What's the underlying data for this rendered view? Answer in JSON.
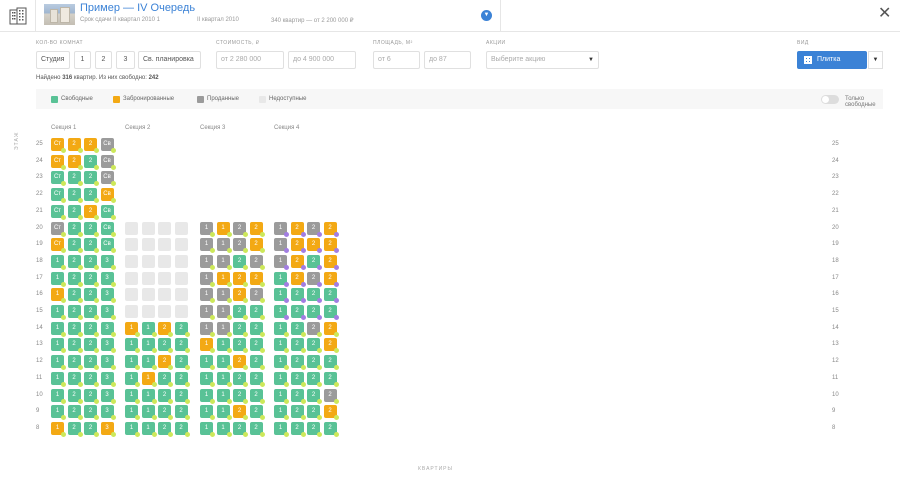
{
  "header": {
    "title": "Пример — IV Очередь",
    "deadline": "Срок сдачи II квартал 2010 1",
    "quarter": "II квартал 2010",
    "apartments": "340 квартир — от 2 200 000 ₽"
  },
  "filters": {
    "rooms": {
      "label": "КОЛ-ВО КОМНАТ",
      "options": [
        "Студия",
        "1",
        "2",
        "3",
        "Св. планировка"
      ]
    },
    "price": {
      "label": "СТОИМОСТЬ, ₽",
      "from": "от  2 280 000",
      "to": "до  4 900 000"
    },
    "area": {
      "label": "ПЛОЩАДЬ, М²",
      "from": "от  6",
      "to": "до  87"
    },
    "promo": {
      "label": "АКЦИИ",
      "placeholder": "Выберите акцию"
    },
    "view": {
      "label": "ВИД",
      "value": "Плитка"
    }
  },
  "summary": {
    "prefix": "Найдено ",
    "total": "316",
    "middle": " квартир. Из них свободно: ",
    "free": "242"
  },
  "legend": {
    "items": [
      {
        "label": "Свободные",
        "color": "#59c296"
      },
      {
        "label": "Забронированные",
        "color": "#f3a914"
      },
      {
        "label": "Проданные",
        "color": "#9b9b9b"
      },
      {
        "label": "Недоступные",
        "color": "#e8e8e8"
      }
    ],
    "toggle_label": "Только свободные"
  },
  "sections": [
    "Секция 1",
    "Секция 2",
    "Секция 3",
    "Секция 4"
  ],
  "axis": {
    "floors_label": "ЭТАЖ",
    "apartments_label": "КВАРТИРЫ"
  },
  "floors": [
    "25",
    "24",
    "23",
    "22",
    "21",
    "20",
    "19",
    "18",
    "17",
    "16",
    "15",
    "14",
    "13",
    "12",
    "11",
    "10",
    "9",
    "8"
  ],
  "grid": [
    [
      "r:Ст,r:2,r:2,s:Св",
      "",
      "",
      ""
    ],
    [
      "r:Ст,r:2,f:2,s:Св",
      "",
      "",
      ""
    ],
    [
      "f:Ст,f:2,f:2,s:Св",
      "",
      "",
      ""
    ],
    [
      "f:Ст,f:2,f:2,r:Св",
      "",
      "",
      ""
    ],
    [
      "f:Ст,f:2,r:2,f:Св",
      "",
      "",
      ""
    ],
    [
      "s:Ст,f:2,f:2,f:Св",
      "n:,n:,n:,n:",
      "s:1,r:1,s:2,r:2",
      "s:1,r:2,s:2,r:2"
    ],
    [
      "r:Ст,f:2,f:2,f:Св",
      "n:,n:,n:,n:",
      "s:1,s:1,s:2,r:2",
      "s:1,r:2,r:2,r:2"
    ],
    [
      "f:1,f:2,f:2,f:3",
      "n:,n:,n:,n:",
      "s:1,s:1,f:2,s:2",
      "s:1,r:2,f:2,r:2"
    ],
    [
      "f:1,f:2,f:2,f:3",
      "n:,n:,n:,n:",
      "s:1,r:1,r:2,r:2",
      "f:1,r:2,s:2,r:2"
    ],
    [
      "r:1,f:2,f:2,f:3",
      "n:,n:,n:,n:",
      "s:1,s:1,r:2,s:2",
      "f:1,f:2,f:2,f:2"
    ],
    [
      "f:1,f:2,f:2,f:3",
      "n:,n:,n:,n:",
      "s:1,s:1,f:2,f:2",
      "f:1,f:2,f:2,f:2"
    ],
    [
      "f:1,f:2,f:2,f:3",
      "r:1,f:1,r:2,f:2",
      "s:1,s:1,f:2,f:2",
      "f:1,f:2,s:2,r:2"
    ],
    [
      "f:1,f:2,f:2,f:3",
      "f:1,f:1,f:2,f:2",
      "r:1,f:1,f:2,f:2",
      "f:1,f:2,f:2,r:2"
    ],
    [
      "f:1,f:2,f:2,f:3",
      "f:1,f:1,r:2,f:2",
      "f:1,f:1,r:2,f:2",
      "f:1,f:2,f:2,f:2"
    ],
    [
      "f:1,f:2,f:2,f:3",
      "f:1,r:1,f:2,f:2",
      "f:1,f:1,f:2,f:2",
      "f:1,f:2,f:2,f:2"
    ],
    [
      "f:1,f:2,f:2,f:3",
      "f:1,f:1,f:2,f:2",
      "f:1,f:1,f:2,f:2",
      "f:1,f:2,f:2,s:2"
    ],
    [
      "f:1,f:2,f:2,f:3",
      "f:1,f:1,f:2,f:2",
      "f:1,f:1,r:2,f:2",
      "f:1,f:2,f:2,r:2"
    ],
    [
      "r:1,f:2,f:2,r:3",
      "f:1,f:1,f:2,f:2",
      "f:1,f:1,f:2,f:2",
      "f:1,f:2,f:2,f:2"
    ]
  ]
}
